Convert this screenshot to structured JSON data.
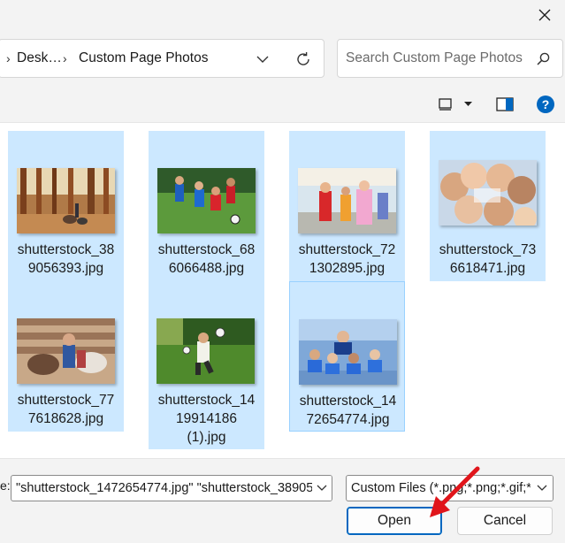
{
  "dialog": {
    "close_icon": "close-icon"
  },
  "address_bar": {
    "crumbs": [
      "Desk...",
      "Custom Page Photos"
    ],
    "first_crumb": "Desk…",
    "current_folder": "Custom Page Photos",
    "dropdown_icon": "chevron-down-icon",
    "refresh_icon": "refresh-icon"
  },
  "search": {
    "placeholder": "Search Custom Page Photos",
    "icon": "search-icon"
  },
  "commands": {
    "view_icon": "view-mode-icon",
    "view_dropdown_icon": "caret-down-icon",
    "preview_pane_icon": "preview-pane-icon",
    "help_icon": "help-icon",
    "help_glyph": "?"
  },
  "files": [
    {
      "name": "shutterstock_389056393.jpg",
      "label_line1": "shutterstock_38",
      "label_line2": "9056393.jpg",
      "label_line3": "",
      "selected": true,
      "scene": "forest dogs"
    },
    {
      "name": "shutterstock_686066488.jpg",
      "label_line1": "shutterstock_68",
      "label_line2": "6066488.jpg",
      "label_line3": "",
      "selected": true,
      "scene": "kids soccer"
    },
    {
      "name": "shutterstock_721302895.jpg",
      "label_line1": "shutterstock_72",
      "label_line2": "1302895.jpg",
      "label_line3": "",
      "selected": true,
      "scene": "kids costumes"
    },
    {
      "name": "shutterstock_736618471.jpg",
      "label_line1": "shutterstock_73",
      "label_line2": "6618471.jpg",
      "label_line3": "",
      "selected": true,
      "scene": "kids faces circle"
    },
    {
      "name": "shutterstock_777618628.jpg",
      "label_line1": "shutterstock_77",
      "label_line2": "7618628.jpg",
      "label_line3": "",
      "selected": true,
      "scene": "kids with goats"
    },
    {
      "name": "shutterstock_1419914186 (1).jpg",
      "label_line1": "shutterstock_14",
      "label_line2": "19914186",
      "label_line3": "(1).jpg",
      "selected": true,
      "scene": "boy with ball"
    },
    {
      "name": "shutterstock_1472654774.jpg",
      "label_line1": "shutterstock_14",
      "label_line2": "72654774.jpg",
      "label_line3": "",
      "selected": true,
      "focused": true,
      "scene": "kids team track"
    }
  ],
  "footer": {
    "filename_label": "e:",
    "filename_value": "\"shutterstock_1472654774.jpg\" \"shutterstock_38905",
    "filetype_value": "Custom Files (*.png;*.png;*.gif;*.",
    "open_label": "Open",
    "cancel_label": "Cancel"
  },
  "colors": {
    "selection": "#cce8ff",
    "selection_border": "#99d1ff",
    "accent": "#0067c0",
    "help": "#0067c0",
    "annotation_arrow": "#e0151b"
  }
}
